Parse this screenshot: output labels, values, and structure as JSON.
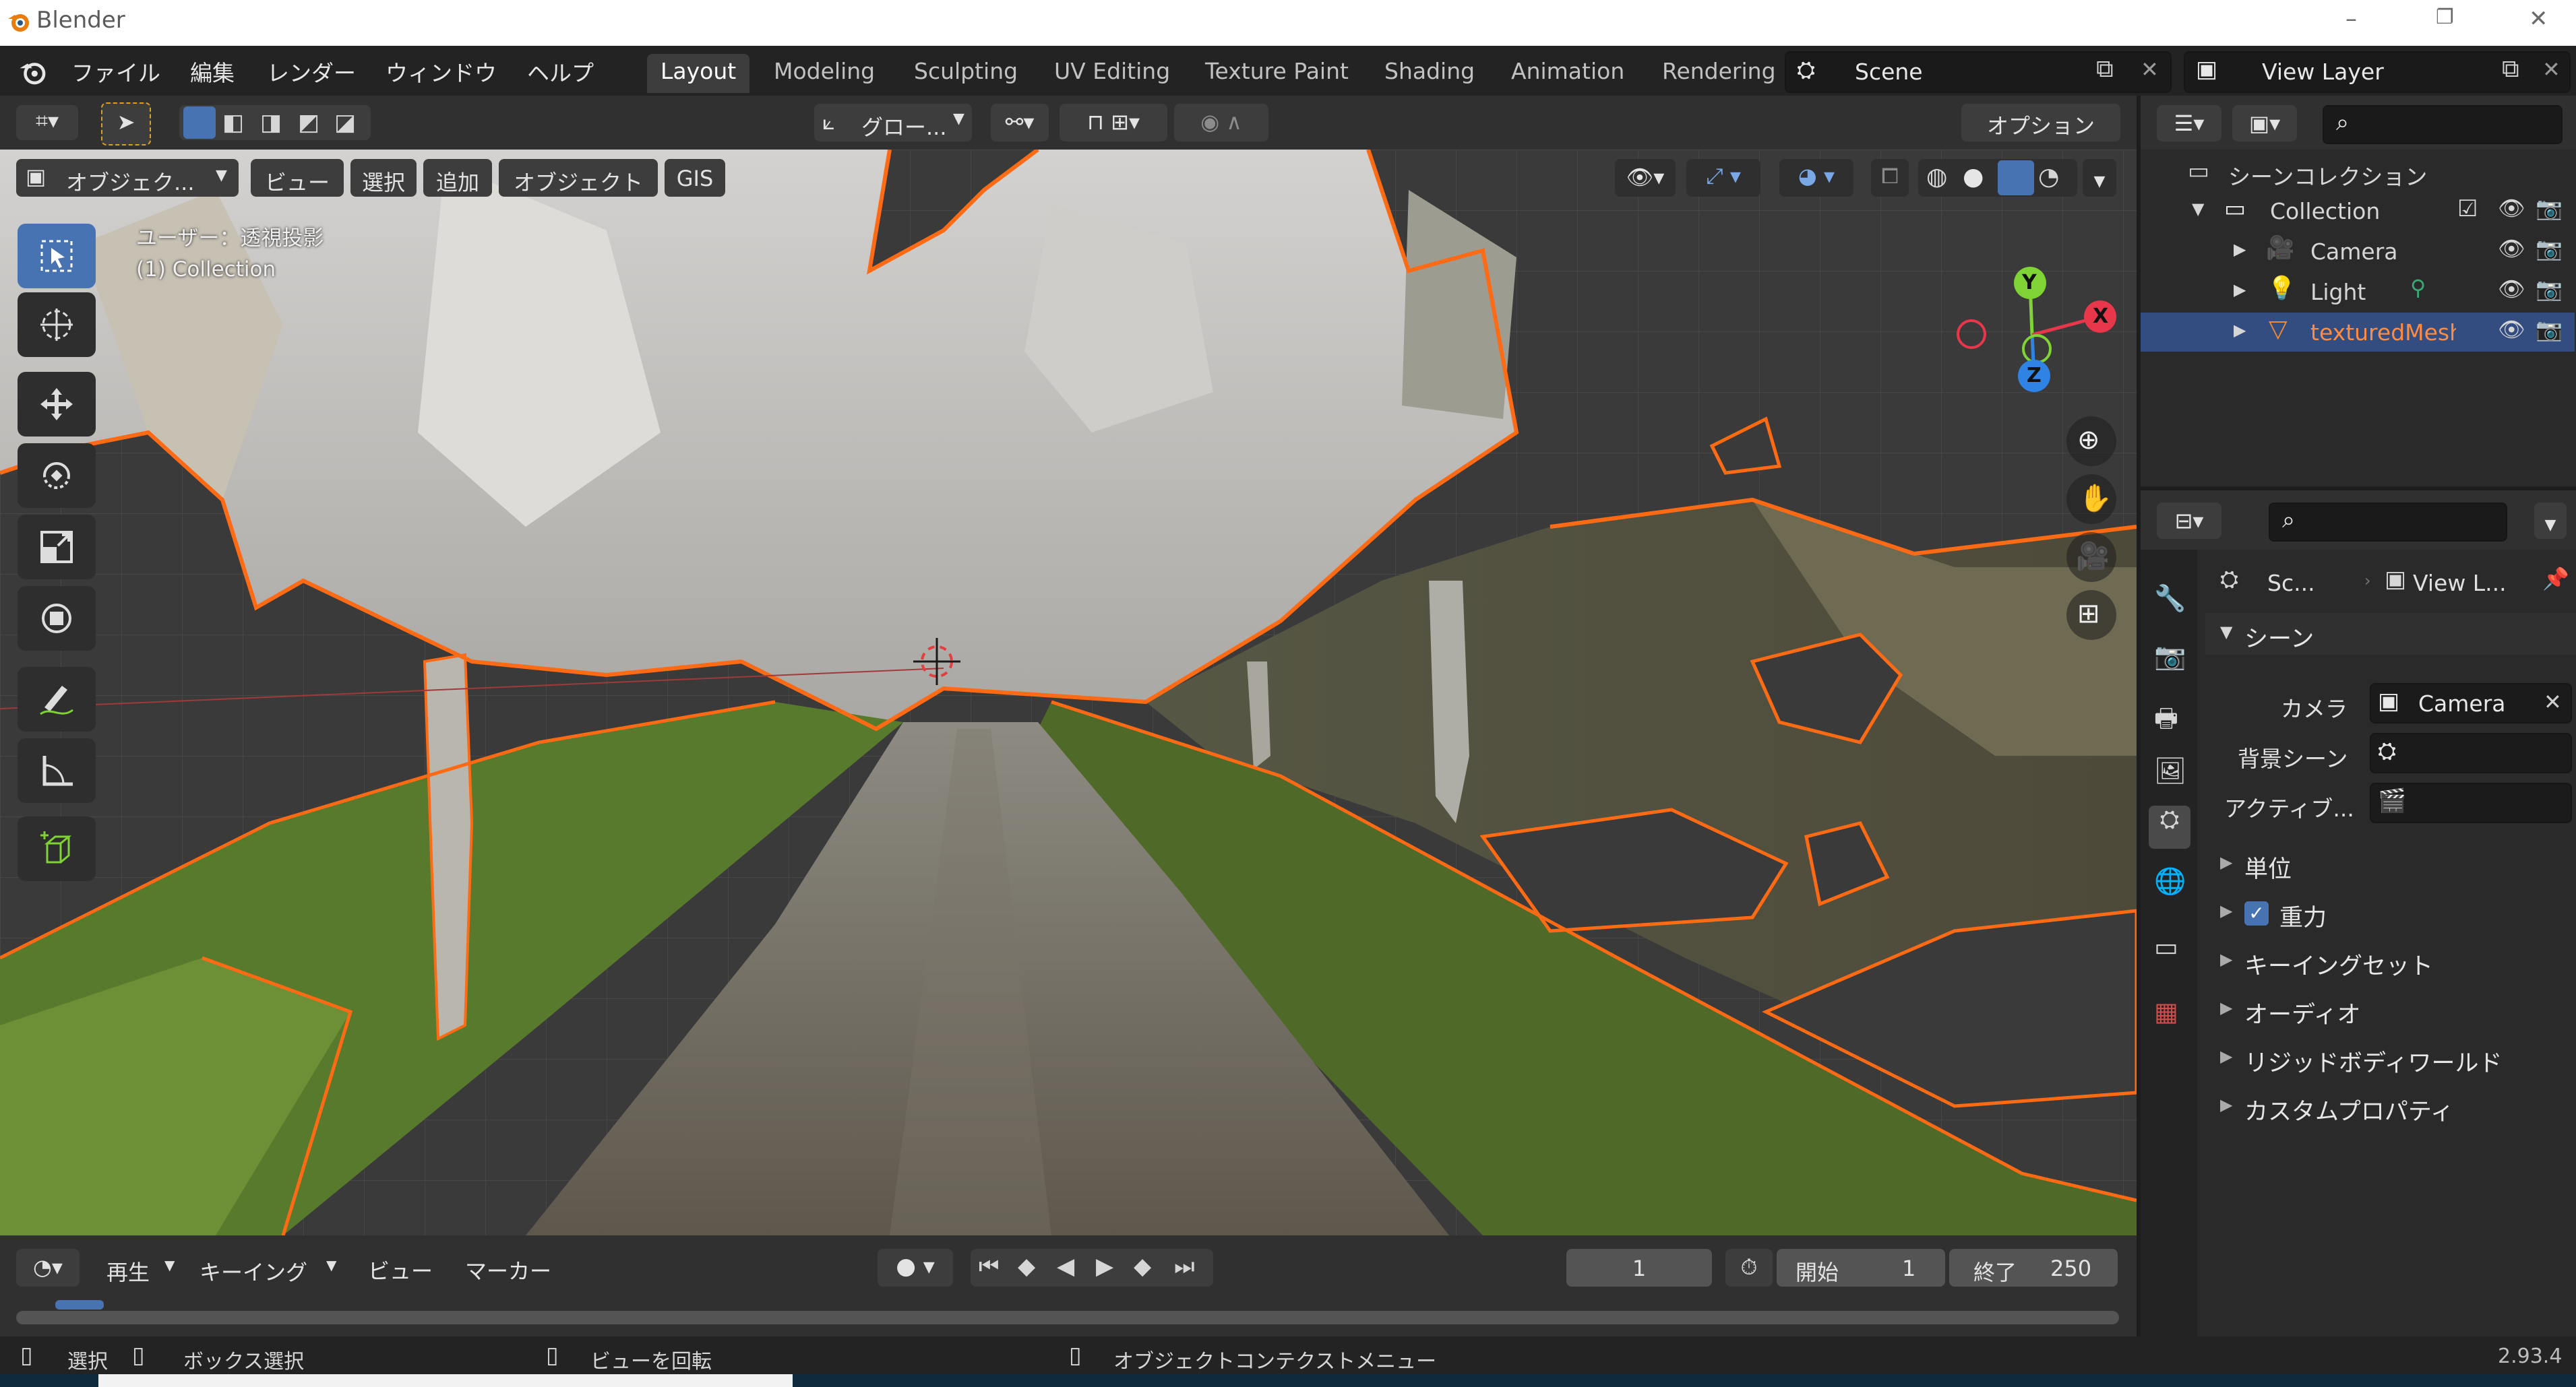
{
  "app": {
    "title": "Blender",
    "version": "2.93.4"
  },
  "menubar": [
    "ファイル",
    "編集",
    "レンダー",
    "ウィンドウ",
    "ヘルプ"
  ],
  "workspaces": [
    {
      "label": "Layout",
      "active": true
    },
    {
      "label": "Modeling",
      "active": false
    },
    {
      "label": "Sculpting",
      "active": false
    },
    {
      "label": "UV Editing",
      "active": false
    },
    {
      "label": "Texture Paint",
      "active": false
    },
    {
      "label": "Shading",
      "active": false
    },
    {
      "label": "Animation",
      "active": false
    },
    {
      "label": "Rendering",
      "active": false
    }
  ],
  "scene_field": "Scene",
  "viewlayer_field": "View Layer",
  "tool_header": {
    "transform_orientation": "グロー...",
    "options": "オプション"
  },
  "view3d_header": {
    "mode": "オブジェク...",
    "menus": [
      "ビュー",
      "選択",
      "追加",
      "オブジェクト",
      "GIS"
    ]
  },
  "viewport_overlay_text": {
    "view_name": "ユーザー：透視投影",
    "collection": "(1) Collection"
  },
  "toolbar_icons": [
    "select-box-icon",
    "cursor-icon",
    "move-icon",
    "rotate-icon",
    "scale-icon",
    "transform-icon",
    "annotate-icon",
    "measure-icon",
    "add-cube-icon"
  ],
  "gizmo_labels": {
    "x": "X",
    "y": "Y",
    "z": "Z"
  },
  "outliner": {
    "root": "シーンコレクション",
    "items": [
      {
        "label": "Collection",
        "depth": 1,
        "icon": "collection-icon",
        "selected": false
      },
      {
        "label": "Camera",
        "depth": 2,
        "icon": "camera-object-icon",
        "selected": false
      },
      {
        "label": "Light",
        "depth": 2,
        "icon": "light-object-icon",
        "selected": false
      },
      {
        "label": "texturedMesh",
        "depth": 2,
        "icon": "mesh-object-icon",
        "selected": true
      }
    ]
  },
  "properties": {
    "breadcrumb_scene": "Sc...",
    "breadcrumb_layer": "View L...",
    "panel_scene": "シーン",
    "camera_label": "カメラ",
    "camera_value": "Camera",
    "background_label": "背景シーン",
    "active_clip_label": "アクティブ...",
    "collapsed_panels": [
      "単位",
      "重力",
      "キーイングセット",
      "オーディオ",
      "リジッドボディワールド",
      "カスタムプロパティ"
    ],
    "gravity_checked": true
  },
  "timeline": {
    "menus": [
      "再生",
      "キーイング",
      "ビュー",
      "マーカー"
    ],
    "current_frame": "1",
    "start_label": "開始",
    "start_value": "1",
    "end_label": "終了",
    "end_value": "250"
  },
  "statusbar": {
    "select": "選択",
    "box_select": "ボックス選択",
    "rotate_view": "ビューを回転",
    "context_menu": "オブジェクトコンテクストメニュー"
  },
  "colors": {
    "accent_blue": "#4773b3",
    "selection_orange": "#ff6a14",
    "axis_x": "#e8364b",
    "axis_y": "#7fd334",
    "axis_z": "#2f83e4"
  }
}
